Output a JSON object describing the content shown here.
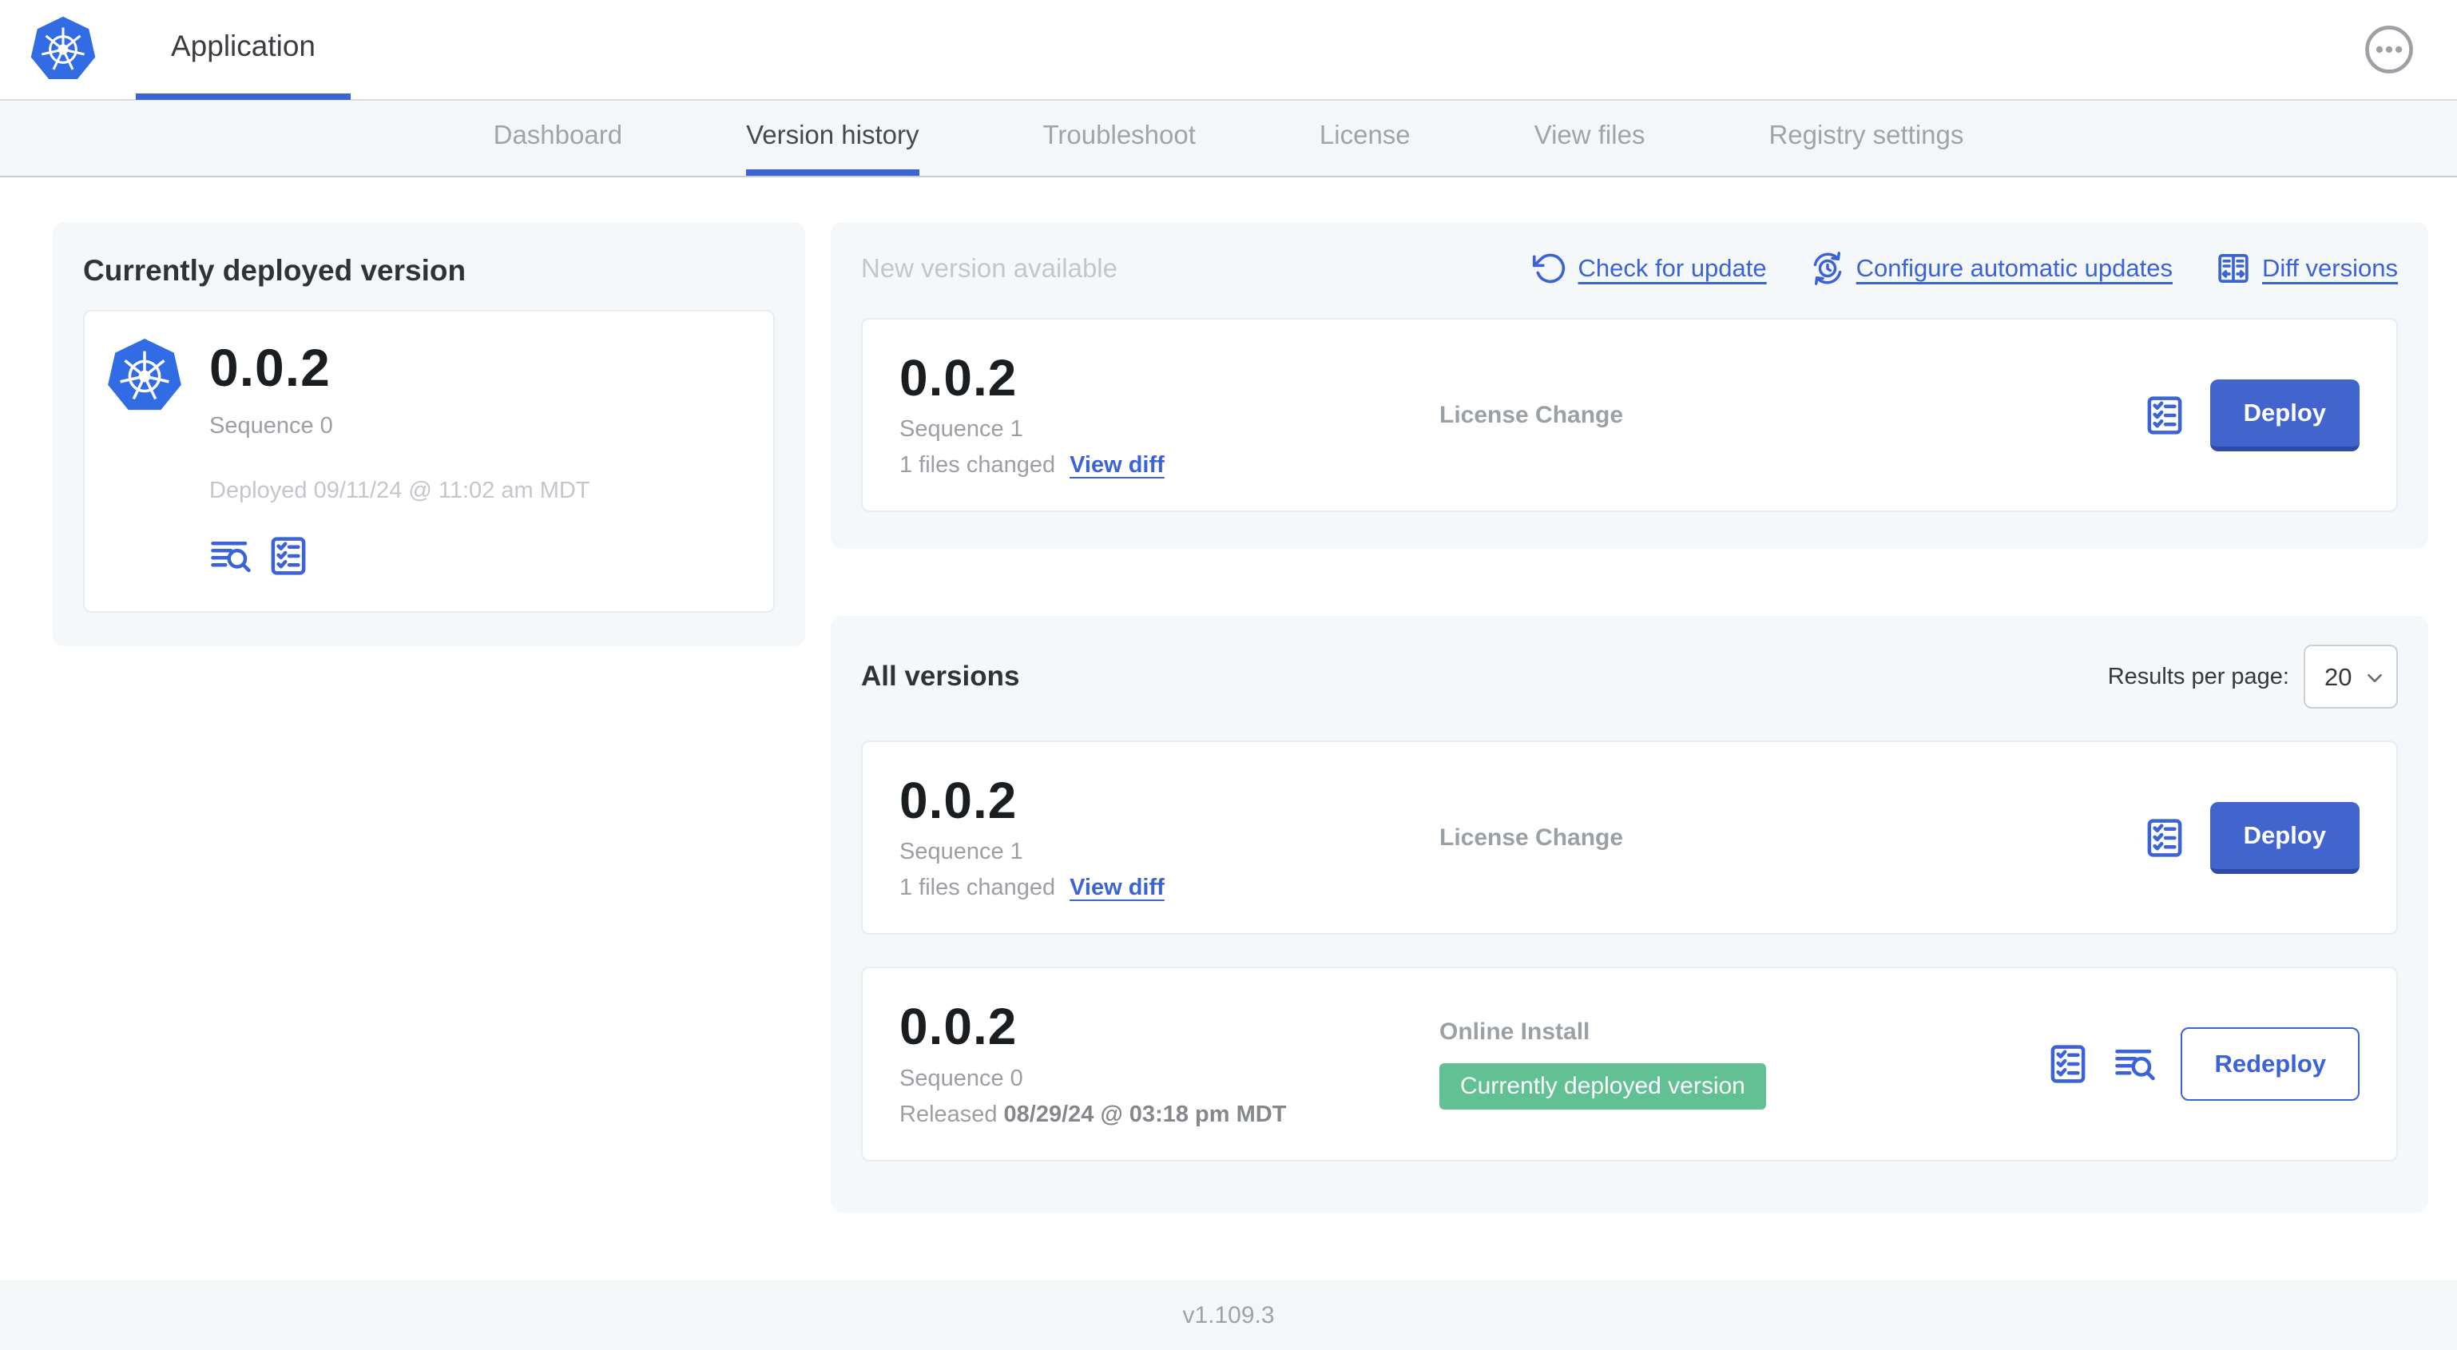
{
  "colors": {
    "accent_blue": "#3b63d6",
    "button_blue": "#4264cd",
    "kubernetes_blue": "#326ce5",
    "badge_green": "#61c195"
  },
  "icons": {
    "app_logo": "kubernetes-wheel-icon",
    "header_more": "ellipsis-circle-icon",
    "check_for_update": "rotate-ccw-icon",
    "configure_automatic_updates": "clock-refresh-icon",
    "diff_versions": "diff-columns-icon",
    "logs": "lines-magnifier-icon",
    "checks": "checklist-icon",
    "select_chevron": "chevron-down-icon"
  },
  "header": {
    "app_title": "Application"
  },
  "nav": {
    "tabs": [
      {
        "label": "Dashboard",
        "active": false
      },
      {
        "label": "Version history",
        "active": true
      },
      {
        "label": "Troubleshoot",
        "active": false
      },
      {
        "label": "License",
        "active": false
      },
      {
        "label": "View files",
        "active": false
      },
      {
        "label": "Registry settings",
        "active": false
      }
    ]
  },
  "current_version": {
    "title": "Currently deployed version",
    "version": "0.0.2",
    "sequence": "Sequence 0",
    "deployed": "Deployed 09/11/24 @ 11:02 am MDT"
  },
  "new_version": {
    "title": "New version available",
    "check_for_update": "Check for update",
    "configure_automatic_updates": "Configure automatic updates",
    "diff_versions": "Diff versions",
    "card": {
      "version": "0.0.2",
      "sequence": "Sequence 1",
      "files_changed": "1 files changed",
      "view_diff": "View diff",
      "source": "License Change",
      "deploy_label": "Deploy"
    }
  },
  "all_versions": {
    "title": "All versions",
    "results_per_page_label": "Results per page:",
    "results_per_page_value": "20",
    "rows": [
      {
        "version": "0.0.2",
        "sequence": "Sequence 1",
        "files_changed": "1 files changed",
        "view_diff": "View diff",
        "source": "License Change",
        "action_label": "Deploy"
      },
      {
        "version": "0.0.2",
        "sequence": "Sequence 0",
        "released_prefix": "Released",
        "released_date": "08/29/24 @ 03:18 pm MDT",
        "source": "Online Install",
        "badge": "Currently deployed version",
        "action_label": "Redeploy"
      }
    ]
  },
  "footer": {
    "version": "v1.109.3"
  }
}
